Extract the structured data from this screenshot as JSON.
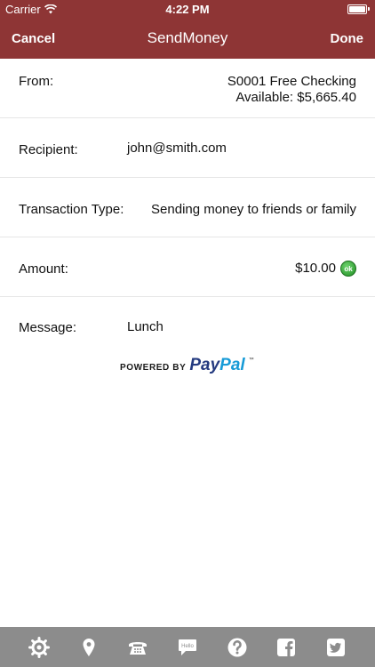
{
  "status_bar": {
    "carrier": "Carrier",
    "time": "4:22 PM"
  },
  "nav": {
    "cancel_label": "Cancel",
    "title": "SendMoney",
    "done_label": "Done"
  },
  "form": {
    "from": {
      "label": "From:",
      "account": "S0001 Free Checking",
      "available": "Available: $5,665.40"
    },
    "recipient": {
      "label": "Recipient:",
      "value": "john@smith.com"
    },
    "transaction_type": {
      "label": "Transaction Type:",
      "value": "Sending money to friends or family"
    },
    "amount": {
      "label": "Amount:",
      "value": "$10.00",
      "badge": "ok"
    },
    "message": {
      "label": "Message:",
      "value": "Lunch"
    }
  },
  "paypal": {
    "powered_by": "POWERED BY",
    "pay": "Pay",
    "pal": "Pal",
    "tm": "™"
  },
  "tabbar": {
    "items": [
      {
        "icon": "gear-icon"
      },
      {
        "icon": "location-pin-icon"
      },
      {
        "icon": "phone-icon"
      },
      {
        "icon": "hello-chat-icon",
        "text": "Hello"
      },
      {
        "icon": "help-icon"
      },
      {
        "icon": "facebook-icon"
      },
      {
        "icon": "twitter-icon"
      }
    ]
  },
  "colors": {
    "brand": "#8e3535",
    "tabbar": "#8c8c8c",
    "paypal_dark": "#253b80",
    "paypal_light": "#179bd7"
  }
}
